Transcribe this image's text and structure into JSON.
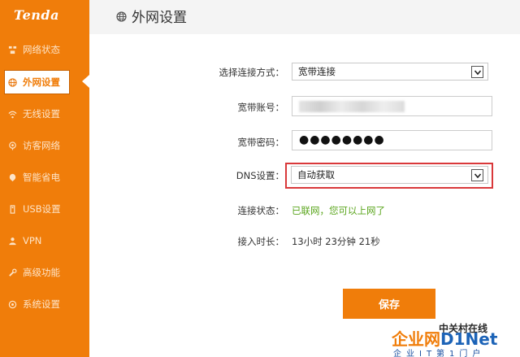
{
  "brand": {
    "logo_text": "Tenda"
  },
  "sidebar": {
    "items": [
      {
        "label": "网络状态",
        "icon": "network-status-icon"
      },
      {
        "label": "外网设置",
        "icon": "globe-icon",
        "active": true
      },
      {
        "label": "无线设置",
        "icon": "wifi-icon"
      },
      {
        "label": "访客网络",
        "icon": "guest-network-icon"
      },
      {
        "label": "智能省电",
        "icon": "power-save-icon"
      },
      {
        "label": "USB设置",
        "icon": "usb-icon"
      },
      {
        "label": "VPN",
        "icon": "vpn-icon"
      },
      {
        "label": "高级功能",
        "icon": "tools-icon"
      },
      {
        "label": "系统设置",
        "icon": "settings-icon"
      }
    ]
  },
  "header": {
    "title": "外网设置",
    "icon": "globe-icon"
  },
  "form": {
    "connection_type": {
      "label": "选择连接方式：",
      "value": "宽带连接"
    },
    "account": {
      "label": "宽带账号：",
      "value": ""
    },
    "password": {
      "label": "宽带密码：",
      "value": "●●●●●●●●"
    },
    "dns": {
      "label": "DNS设置：",
      "value": "自动获取"
    },
    "status": {
      "label": "连接状态：",
      "value": "已联网，您可以上网了",
      "color": "#5aa51c"
    },
    "uptime": {
      "label": "接入时长：",
      "value": "13小时 23分钟 21秒"
    },
    "save_label": "保存"
  },
  "watermark": {
    "top_text": "中关村在线",
    "main_left": "企业网",
    "main_right": "D1Net",
    "sub_text": "企业IT第1门户"
  },
  "colors": {
    "accent": "#f07d0a",
    "highlight_border": "#d9383a"
  }
}
